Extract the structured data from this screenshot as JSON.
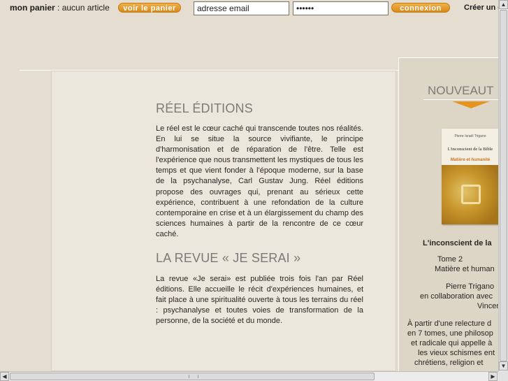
{
  "header": {
    "cart_label": "mon panier",
    "cart_sep": " : ",
    "cart_status": "aucun article",
    "cart_button": "voir le panier",
    "email_placeholder": "adresse email",
    "password_value": "••••••",
    "login_button": "connexion",
    "create_account": "Créer un c"
  },
  "main": {
    "section1_title": "RÉEL ÉDITIONS",
    "section1_text": "Le réel est le cœur caché qui transcende toutes nos réalités. En lui se situe la source vivifiante, le principe d'harmonisation et de réparation de l'être. Telle est l'expérience que nous transmettent les mystiques de tous les temps et que vient fonder à l'époque moderne, sur la base de la psychanalyse, Carl Gustav Jung. Réel éditions propose des ouvrages qui, prenant au sérieux cette expérience, contribuent à une refondation de la culture contemporaine en crise et à un élargissement du champ des sciences humaines à partir de la rencontre de ce cœur caché.",
    "section2_title": "LA REVUE « JE SERAI »",
    "section2_text": "La revue «Je serai» est publiée trois fois l'an par Réel éditions. Elle accueille le récit d'expériences humaines, et fait place à une spiritualité ouverte à tous les terrains du réel : psychanalyse et toutes voies de transformation de la personne, de la société et du monde."
  },
  "sidebar": {
    "title": "NOUVEAUT",
    "book_cover": {
      "author": "Pierre Israël Trigano",
      "title": "L'inconscient de la Bible",
      "subtitle": "Matière et humanité"
    },
    "book_title": "L'inconscient de la",
    "lines": [
      "Tome 2",
      "Matière et human",
      "Pierre Trigano",
      "en collaboration avec",
      "Vincent",
      "À partir d'une relecture d",
      "en 7 tomes, une philosop",
      "et radicale qui appelle à",
      "les vieux schismes ent",
      "chrétiens, religion et"
    ]
  },
  "icons": {
    "scroll_up": "arrow-up-icon",
    "scroll_down": "arrow-down-icon",
    "scroll_left": "arrow-left-icon",
    "scroll_right": "arrow-right-icon"
  },
  "colors": {
    "accent": "#e6941f",
    "background": "#e4ddd0",
    "title_gray": "#7c7a76"
  }
}
